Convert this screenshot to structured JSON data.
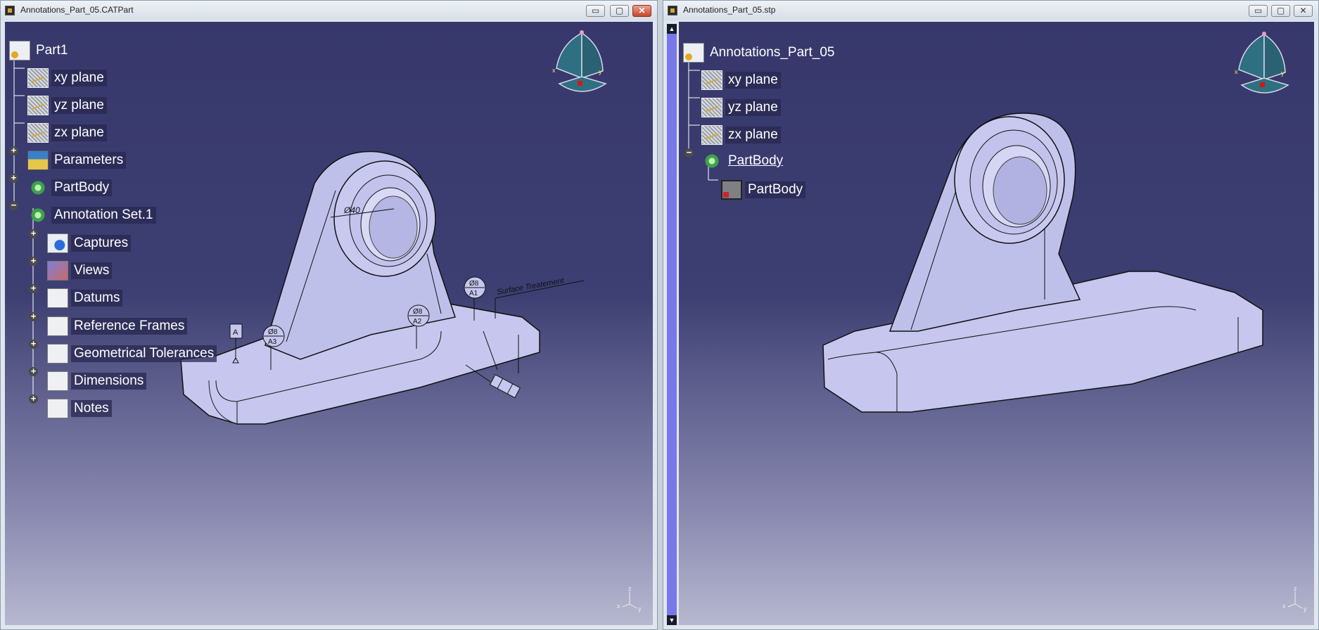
{
  "left_window": {
    "title": "Annotations_Part_05.CATPart",
    "buttons": {
      "minimize": "▭",
      "maximize": "▢",
      "close": "✕"
    },
    "tree": {
      "root": "Part1",
      "items": [
        {
          "label": "xy plane",
          "icon": "plane-icon"
        },
        {
          "label": "yz plane",
          "icon": "plane-icon"
        },
        {
          "label": "zx plane",
          "icon": "plane-icon"
        },
        {
          "label": "Parameters",
          "icon": "parameters-icon"
        },
        {
          "label": "PartBody",
          "icon": "partbody-icon"
        },
        {
          "label": "Annotation Set.1",
          "icon": "annotation-set-icon"
        },
        {
          "label": "Captures",
          "icon": "captures-icon"
        },
        {
          "label": "Views",
          "icon": "views-icon"
        },
        {
          "label": "Datums",
          "icon": "datums-icon"
        },
        {
          "label": "Reference Frames",
          "icon": "reference-frames-icon"
        },
        {
          "label": "Geometrical Tolerances",
          "icon": "geometrical-tolerances-icon"
        },
        {
          "label": "Dimensions",
          "icon": "dimensions-icon"
        },
        {
          "label": "Notes",
          "icon": "notes-icon"
        }
      ]
    },
    "annotations": {
      "dimension": "Ø40 ",
      "datum_a": "A",
      "hole_a3": {
        "dia": "Ø8",
        "ref": "A3"
      },
      "hole_a2": {
        "dia": "Ø8",
        "ref": "A2"
      },
      "hole_a1": {
        "dia": "Ø8",
        "ref": "A1"
      },
      "surface_note": "Surface Treatement"
    },
    "axis_labels": {
      "x": "x",
      "y": "y",
      "z": "z"
    }
  },
  "right_window": {
    "title": "Annotations_Part_05.stp",
    "buttons": {
      "minimize": "▭",
      "maximize": "▢",
      "close": "✕"
    },
    "tree": {
      "root": "Annotations_Part_05",
      "items": [
        {
          "label": "xy plane",
          "icon": "plane-icon"
        },
        {
          "label": "yz plane",
          "icon": "plane-icon"
        },
        {
          "label": "zx plane",
          "icon": "plane-icon"
        },
        {
          "label": "PartBody",
          "icon": "partbody-icon"
        },
        {
          "label": "PartBody",
          "icon": "body-icon"
        }
      ]
    },
    "axis_labels": {
      "x": "x",
      "y": "y",
      "z": "z"
    }
  },
  "colors": {
    "viewport_top": "#37376b",
    "viewport_bottom": "#b7b8cf",
    "part_fill": "#c6c6ee",
    "part_edge": "#111111",
    "scrollbar": "#7878ea"
  }
}
